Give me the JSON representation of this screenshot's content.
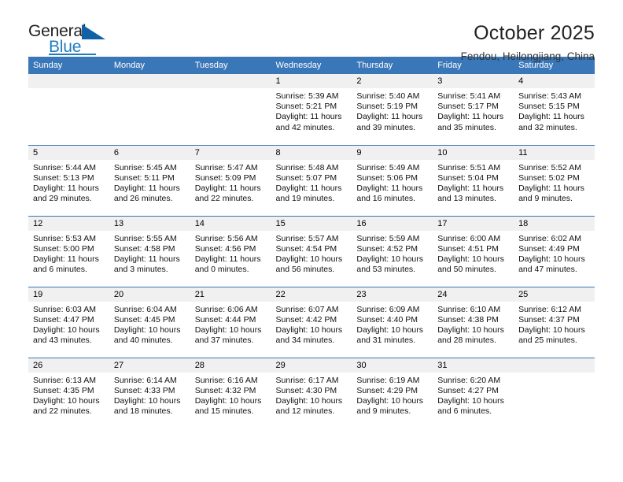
{
  "brand": {
    "name_top": "General",
    "name_bottom": "Blue",
    "accent_color": "#1f7bc1",
    "triangle_color": "#1161a8"
  },
  "header": {
    "title": "October 2025",
    "subtitle": "Fendou, Heilongjiang, China"
  },
  "theme": {
    "header_blue": "#3a77b8",
    "daynum_bg": "#f0f0f0"
  },
  "calendar": {
    "weekday_headers": [
      "Sunday",
      "Monday",
      "Tuesday",
      "Wednesday",
      "Thursday",
      "Friday",
      "Saturday"
    ],
    "labels": {
      "sunrise": "Sunrise:",
      "sunset": "Sunset:",
      "daylight": "Daylight:"
    },
    "weeks": [
      [
        {
          "day": "",
          "sunrise": "",
          "sunset": "",
          "daylight": ""
        },
        {
          "day": "",
          "sunrise": "",
          "sunset": "",
          "daylight": ""
        },
        {
          "day": "",
          "sunrise": "",
          "sunset": "",
          "daylight": ""
        },
        {
          "day": "1",
          "sunrise": "Sunrise: 5:39 AM",
          "sunset": "Sunset: 5:21 PM",
          "daylight": "Daylight: 11 hours and 42 minutes."
        },
        {
          "day": "2",
          "sunrise": "Sunrise: 5:40 AM",
          "sunset": "Sunset: 5:19 PM",
          "daylight": "Daylight: 11 hours and 39 minutes."
        },
        {
          "day": "3",
          "sunrise": "Sunrise: 5:41 AM",
          "sunset": "Sunset: 5:17 PM",
          "daylight": "Daylight: 11 hours and 35 minutes."
        },
        {
          "day": "4",
          "sunrise": "Sunrise: 5:43 AM",
          "sunset": "Sunset: 5:15 PM",
          "daylight": "Daylight: 11 hours and 32 minutes."
        }
      ],
      [
        {
          "day": "5",
          "sunrise": "Sunrise: 5:44 AM",
          "sunset": "Sunset: 5:13 PM",
          "daylight": "Daylight: 11 hours and 29 minutes."
        },
        {
          "day": "6",
          "sunrise": "Sunrise: 5:45 AM",
          "sunset": "Sunset: 5:11 PM",
          "daylight": "Daylight: 11 hours and 26 minutes."
        },
        {
          "day": "7",
          "sunrise": "Sunrise: 5:47 AM",
          "sunset": "Sunset: 5:09 PM",
          "daylight": "Daylight: 11 hours and 22 minutes."
        },
        {
          "day": "8",
          "sunrise": "Sunrise: 5:48 AM",
          "sunset": "Sunset: 5:07 PM",
          "daylight": "Daylight: 11 hours and 19 minutes."
        },
        {
          "day": "9",
          "sunrise": "Sunrise: 5:49 AM",
          "sunset": "Sunset: 5:06 PM",
          "daylight": "Daylight: 11 hours and 16 minutes."
        },
        {
          "day": "10",
          "sunrise": "Sunrise: 5:51 AM",
          "sunset": "Sunset: 5:04 PM",
          "daylight": "Daylight: 11 hours and 13 minutes."
        },
        {
          "day": "11",
          "sunrise": "Sunrise: 5:52 AM",
          "sunset": "Sunset: 5:02 PM",
          "daylight": "Daylight: 11 hours and 9 minutes."
        }
      ],
      [
        {
          "day": "12",
          "sunrise": "Sunrise: 5:53 AM",
          "sunset": "Sunset: 5:00 PM",
          "daylight": "Daylight: 11 hours and 6 minutes."
        },
        {
          "day": "13",
          "sunrise": "Sunrise: 5:55 AM",
          "sunset": "Sunset: 4:58 PM",
          "daylight": "Daylight: 11 hours and 3 minutes."
        },
        {
          "day": "14",
          "sunrise": "Sunrise: 5:56 AM",
          "sunset": "Sunset: 4:56 PM",
          "daylight": "Daylight: 11 hours and 0 minutes."
        },
        {
          "day": "15",
          "sunrise": "Sunrise: 5:57 AM",
          "sunset": "Sunset: 4:54 PM",
          "daylight": "Daylight: 10 hours and 56 minutes."
        },
        {
          "day": "16",
          "sunrise": "Sunrise: 5:59 AM",
          "sunset": "Sunset: 4:52 PM",
          "daylight": "Daylight: 10 hours and 53 minutes."
        },
        {
          "day": "17",
          "sunrise": "Sunrise: 6:00 AM",
          "sunset": "Sunset: 4:51 PM",
          "daylight": "Daylight: 10 hours and 50 minutes."
        },
        {
          "day": "18",
          "sunrise": "Sunrise: 6:02 AM",
          "sunset": "Sunset: 4:49 PM",
          "daylight": "Daylight: 10 hours and 47 minutes."
        }
      ],
      [
        {
          "day": "19",
          "sunrise": "Sunrise: 6:03 AM",
          "sunset": "Sunset: 4:47 PM",
          "daylight": "Daylight: 10 hours and 43 minutes."
        },
        {
          "day": "20",
          "sunrise": "Sunrise: 6:04 AM",
          "sunset": "Sunset: 4:45 PM",
          "daylight": "Daylight: 10 hours and 40 minutes."
        },
        {
          "day": "21",
          "sunrise": "Sunrise: 6:06 AM",
          "sunset": "Sunset: 4:44 PM",
          "daylight": "Daylight: 10 hours and 37 minutes."
        },
        {
          "day": "22",
          "sunrise": "Sunrise: 6:07 AM",
          "sunset": "Sunset: 4:42 PM",
          "daylight": "Daylight: 10 hours and 34 minutes."
        },
        {
          "day": "23",
          "sunrise": "Sunrise: 6:09 AM",
          "sunset": "Sunset: 4:40 PM",
          "daylight": "Daylight: 10 hours and 31 minutes."
        },
        {
          "day": "24",
          "sunrise": "Sunrise: 6:10 AM",
          "sunset": "Sunset: 4:38 PM",
          "daylight": "Daylight: 10 hours and 28 minutes."
        },
        {
          "day": "25",
          "sunrise": "Sunrise: 6:12 AM",
          "sunset": "Sunset: 4:37 PM",
          "daylight": "Daylight: 10 hours and 25 minutes."
        }
      ],
      [
        {
          "day": "26",
          "sunrise": "Sunrise: 6:13 AM",
          "sunset": "Sunset: 4:35 PM",
          "daylight": "Daylight: 10 hours and 22 minutes."
        },
        {
          "day": "27",
          "sunrise": "Sunrise: 6:14 AM",
          "sunset": "Sunset: 4:33 PM",
          "daylight": "Daylight: 10 hours and 18 minutes."
        },
        {
          "day": "28",
          "sunrise": "Sunrise: 6:16 AM",
          "sunset": "Sunset: 4:32 PM",
          "daylight": "Daylight: 10 hours and 15 minutes."
        },
        {
          "day": "29",
          "sunrise": "Sunrise: 6:17 AM",
          "sunset": "Sunset: 4:30 PM",
          "daylight": "Daylight: 10 hours and 12 minutes."
        },
        {
          "day": "30",
          "sunrise": "Sunrise: 6:19 AM",
          "sunset": "Sunset: 4:29 PM",
          "daylight": "Daylight: 10 hours and 9 minutes."
        },
        {
          "day": "31",
          "sunrise": "Sunrise: 6:20 AM",
          "sunset": "Sunset: 4:27 PM",
          "daylight": "Daylight: 10 hours and 6 minutes."
        },
        {
          "day": "",
          "sunrise": "",
          "sunset": "",
          "daylight": ""
        }
      ]
    ]
  }
}
